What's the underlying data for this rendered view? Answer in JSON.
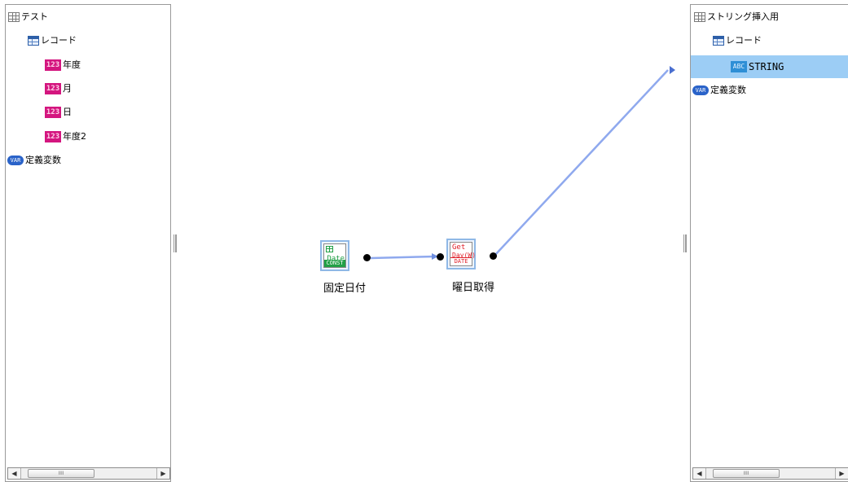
{
  "left_tree": {
    "root": "テスト",
    "record": "レコード",
    "fields": [
      {
        "icon": "123",
        "label": "年度"
      },
      {
        "icon": "123",
        "label": "月"
      },
      {
        "icon": "123",
        "label": "日"
      },
      {
        "icon": "123",
        "label": "年度2"
      }
    ],
    "variables": "定義変数",
    "var_icon": "VAR"
  },
  "right_tree": {
    "root": "ストリング挿入用",
    "record": "レコード",
    "fields": [
      {
        "icon": "ABC",
        "label": "STRING"
      }
    ],
    "variables": "定義変数",
    "var_icon": "VAR"
  },
  "nodes": {
    "const_date": {
      "line1": "Date",
      "type_tag": "CONST",
      "label": "固定日付"
    },
    "get_day": {
      "line1": "Get",
      "line2": "Day(W)",
      "type_tag": "DATE",
      "label": "曜日取得"
    }
  },
  "colors": {
    "connector": "#8fa9ee",
    "selected_row": "#9ccdf5",
    "const_green": "#22a046",
    "date_red": "#e0202a"
  },
  "scrollbar": {
    "grip": "IIII"
  }
}
